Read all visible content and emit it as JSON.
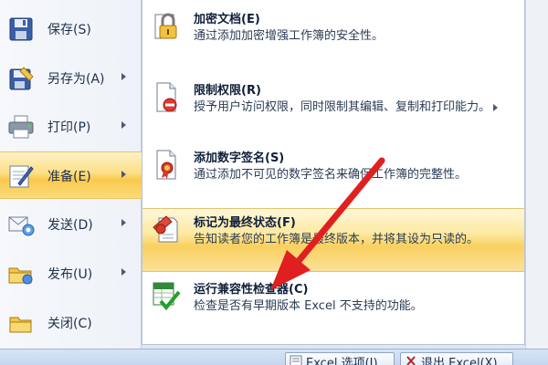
{
  "left_menu": {
    "items": [
      {
        "label": "保存(S)"
      },
      {
        "label": "另存为(A)"
      },
      {
        "label": "打印(P)"
      },
      {
        "label": "准备(E)"
      },
      {
        "label": "发送(D)"
      },
      {
        "label": "发布(U)"
      },
      {
        "label": "关闭(C)"
      }
    ],
    "active_item": "准备(E)"
  },
  "submenu": {
    "items": [
      {
        "title": "加密文档(E)",
        "desc": "通过添加加密增强工作簿的安全性。"
      },
      {
        "title": "限制权限(R)",
        "desc": "授予用户访问权限，同时限制其编辑、复制和打印能力。"
      },
      {
        "title": "添加数字签名(S)",
        "desc": "通过添加不可见的数字签名来确保工作簿的完整性。"
      },
      {
        "title": "标记为最终状态(F)",
        "desc": "告知读者您的工作簿是最终版本，并将其设为只读的。"
      },
      {
        "title": "运行兼容性检查器(C)",
        "desc": "检查是否有早期版本 Excel 不支持的功能。"
      }
    ],
    "highlighted_item": "标记为最终状态(F)"
  },
  "bottom_bar": {
    "options_label": "Excel 选项(I)",
    "exit_label": "退出 Excel(X)"
  },
  "colors": {
    "highlight": "#f9c94d",
    "arrow": "#e02020",
    "menu_bg": "#f6f8fb",
    "bottom_bar": "#c6d6ee"
  }
}
